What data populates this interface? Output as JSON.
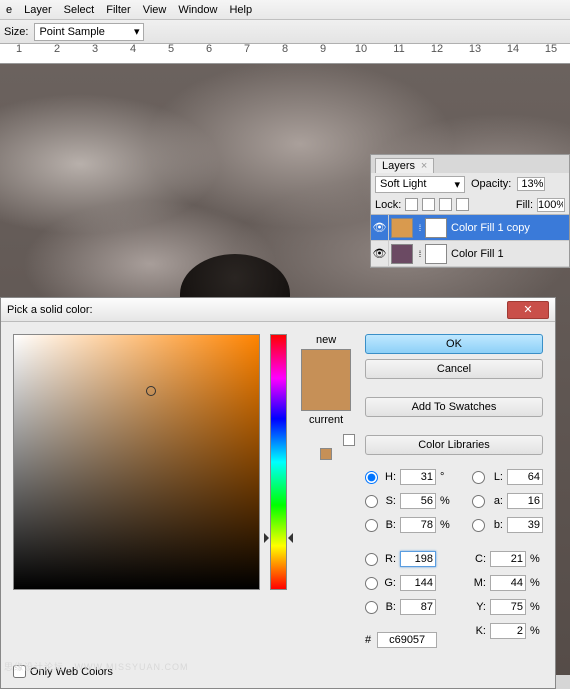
{
  "menu": {
    "items": [
      "e",
      "Layer",
      "Select",
      "Filter",
      "View",
      "Window",
      "Help"
    ]
  },
  "toolopts": {
    "size_label": "Size:",
    "sample_value": "Point Sample"
  },
  "ruler": {
    "ticks": [
      "1",
      "2",
      "3",
      "4",
      "5",
      "6",
      "7",
      "8",
      "9",
      "10",
      "11",
      "12",
      "13",
      "14",
      "15"
    ]
  },
  "layers": {
    "tab": "Layers",
    "blend_mode": "Soft Light",
    "opacity_label": "Opacity:",
    "opacity_value": "13%",
    "lock_label": "Lock:",
    "fill_label": "Fill:",
    "fill_value": "100%",
    "entries": [
      {
        "name": "Color Fill 1 copy",
        "color": "#d99a4e",
        "selected": true
      },
      {
        "name": "Color Fill 1",
        "color": "#6b4a63",
        "selected": false
      }
    ]
  },
  "picker": {
    "title": "Pick a solid color:",
    "btn_ok": "OK",
    "btn_cancel": "Cancel",
    "btn_swatches": "Add To Swatches",
    "btn_libraries": "Color Libraries",
    "lbl_new": "new",
    "lbl_current": "current",
    "color_new": "#c69057",
    "color_current": "#c69057",
    "marker": {
      "left": "54%",
      "top": "20%"
    },
    "fields": {
      "H": "31",
      "H_u": "°",
      "S": "56",
      "S_u": "%",
      "B": "78",
      "B_u": "%",
      "R": "198",
      "G": "144",
      "Bb": "87",
      "L": "64",
      "a": "16",
      "b": "39",
      "C": "21",
      "M": "44",
      "Y": "75",
      "K": "2"
    },
    "hex_label": "#",
    "hex_value": "c69057",
    "webcolors_label": "Only Web Colors"
  },
  "watermark": "思缘设计论坛 . WWW.MISSYUAN.COM"
}
